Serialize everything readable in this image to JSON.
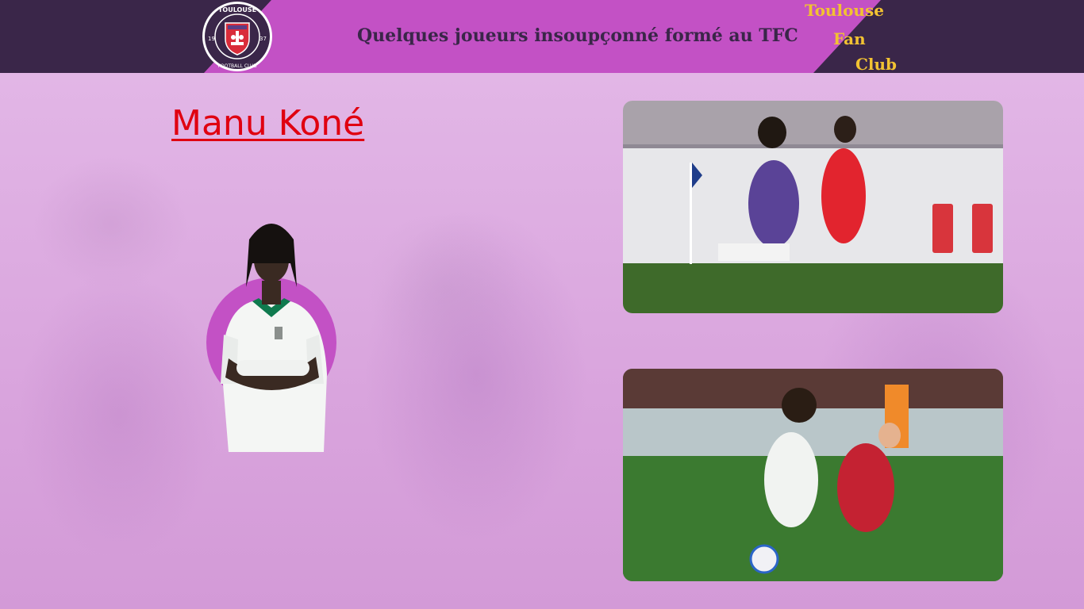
{
  "header": {
    "title": "Quelques joueurs insoupçonné formé au TFC",
    "brand_line1": "Toulouse",
    "brand_line2": "Fan",
    "brand_line3": "Club",
    "logo": {
      "top_text": "TOULOUSE",
      "bottom_text": "FOOTBALL CLUB",
      "left_num": "19",
      "right_num": "37"
    }
  },
  "main": {
    "player_name": "Manu Koné"
  },
  "colors": {
    "header_dark": "#3a2649",
    "header_band": "#c351c5",
    "brand_text": "#f2c232",
    "player_name": "#e00010",
    "background": "#dba6df"
  }
}
